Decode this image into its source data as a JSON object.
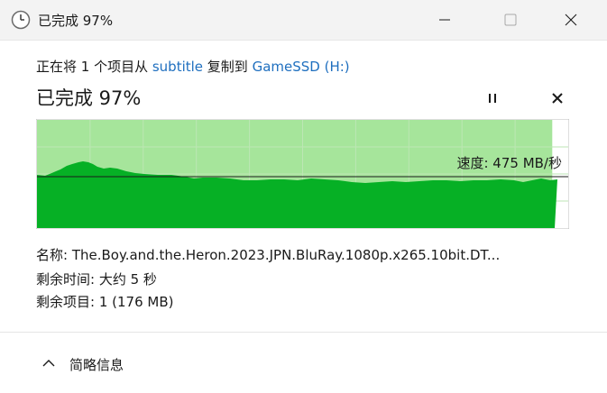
{
  "window": {
    "title": "已完成 97%",
    "icon": "clock-icon",
    "controls": [
      "minimize-icon",
      "maximize-icon",
      "close-icon"
    ]
  },
  "copy": {
    "prefix": "正在将 1 个项目从 ",
    "source": "subtitle",
    "middle": " 复制到 ",
    "destination": "GameSSD (H:)"
  },
  "progress": {
    "status": "已完成 97%",
    "percent": 97,
    "pause_icon": "pause-icon",
    "cancel_icon": "close-icon",
    "speed_label": "速度: 475 MB/秒"
  },
  "details": {
    "name_label": "名称:",
    "name_value": "The.Boy.and.the.Heron.2023.JPN.BluRay.1080p.x265.10bit.DT...",
    "time_label": "剩余时间:",
    "time_value": "大约 5 秒",
    "items_label": "剩余项目:",
    "items_value": "1 (176 MB)"
  },
  "footer": {
    "label": "简略信息",
    "icon": "chevron-up-icon"
  },
  "colors": {
    "graph_fill": "#06b025",
    "graph_bg": "#a6e59b",
    "graph_border": "#bcbcbc",
    "grid": "#bde6b4",
    "link": "#1f6fbf"
  }
}
